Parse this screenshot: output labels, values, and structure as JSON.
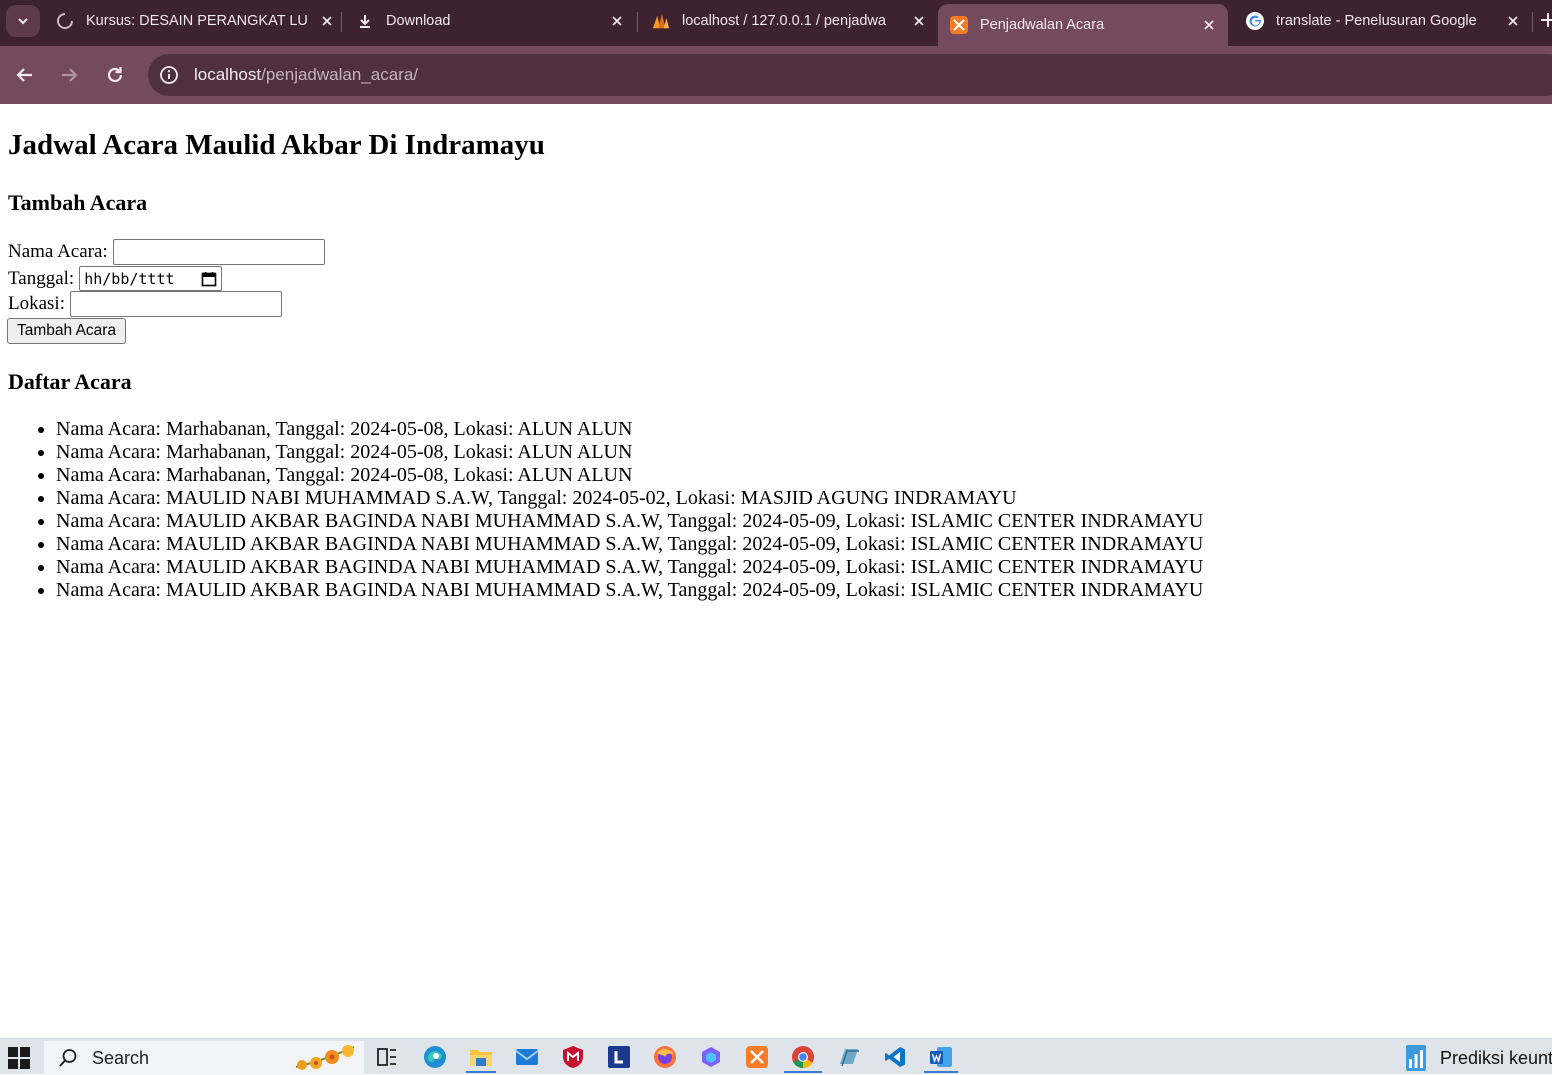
{
  "browser": {
    "tabs": [
      {
        "label": "Kursus: DESAIN PERANGKAT LU",
        "icon": "loading-spinner-icon"
      },
      {
        "label": "Download",
        "icon": "download-icon"
      },
      {
        "label": "localhost / 127.0.0.1 / penjadwa",
        "icon": "phpmyadmin-icon"
      },
      {
        "label": "Penjadwalan Acara",
        "icon": "xampp-icon",
        "active": true
      },
      {
        "label": "translate - Penelusuran Google",
        "icon": "google-icon"
      }
    ],
    "url_host": "localhost",
    "url_path": "/penjadwalan_acara/"
  },
  "page": {
    "title": "Jadwal Acara Maulid Akbar Di Indramayu",
    "form_heading": "Tambah Acara",
    "name_label": "Nama Acara:",
    "name_value": "",
    "date_label": "Tanggal:",
    "date_placeholder": "hh/bb/tttt",
    "location_label": "Lokasi:",
    "location_value": "",
    "submit_label": "Tambah Acara",
    "list_heading": "Daftar Acara",
    "events": [
      "Nama Acara: Marhabanan, Tanggal: 2024-05-08, Lokasi: ALUN ALUN",
      "Nama Acara: Marhabanan, Tanggal: 2024-05-08, Lokasi: ALUN ALUN",
      "Nama Acara: Marhabanan, Tanggal: 2024-05-08, Lokasi: ALUN ALUN",
      "Nama Acara: MAULID NABI MUHAMMAD S.A.W, Tanggal: 2024-05-02, Lokasi: MASJID AGUNG INDRAMAYU",
      "Nama Acara: MAULID AKBAR BAGINDA NABI MUHAMMAD S.A.W, Tanggal: 2024-05-09, Lokasi: ISLAMIC CENTER INDRAMAYU",
      "Nama Acara: MAULID AKBAR BAGINDA NABI MUHAMMAD S.A.W, Tanggal: 2024-05-09, Lokasi: ISLAMIC CENTER INDRAMAYU",
      "Nama Acara: MAULID AKBAR BAGINDA NABI MUHAMMAD S.A.W, Tanggal: 2024-05-09, Lokasi: ISLAMIC CENTER INDRAMAYU",
      "Nama Acara: MAULID AKBAR BAGINDA NABI MUHAMMAD S.A.W, Tanggal: 2024-05-09, Lokasi: ISLAMIC CENTER INDRAMAYU"
    ]
  },
  "taskbar": {
    "search_label": "Search",
    "widget_label": "Prediksi keunt",
    "apps": [
      "task-view-icon",
      "edge-icon",
      "file-explorer-icon",
      "mail-icon",
      "mcafee-icon",
      "l-app-icon",
      "firefox-icon",
      "copilot-icon",
      "xampp-icon",
      "chrome-icon",
      "notes-icon",
      "vscode-icon",
      "word-icon"
    ]
  },
  "colors": {
    "tabbar_bg": "#3d2230",
    "toolbar_bg": "#744a5e",
    "omnibox_bg": "#4f3040",
    "taskbar_bg": "#dfe3ea"
  }
}
